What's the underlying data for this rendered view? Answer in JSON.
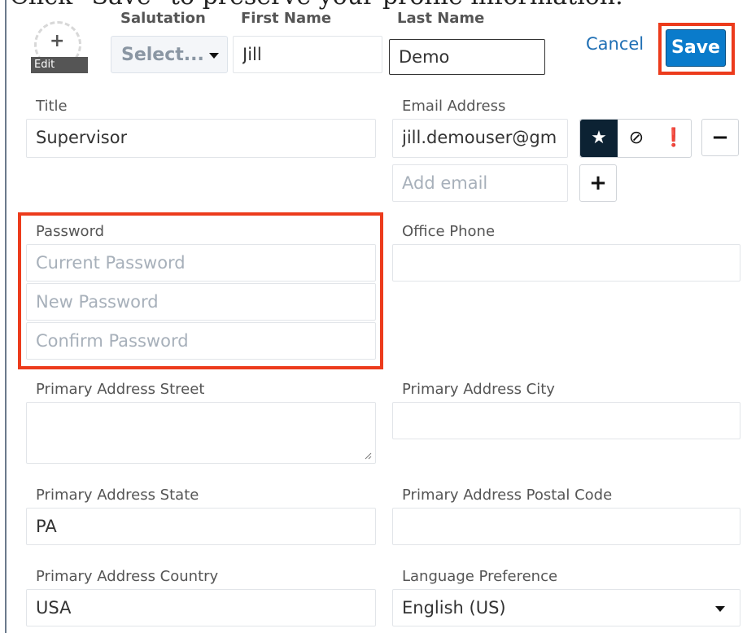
{
  "caption": "Click \"Save\" to preserve your profile information.",
  "header": {
    "avatar_edit_label": "Edit",
    "salutation_label": "Salutation",
    "salutation_value": "Select...",
    "first_name_label": "First Name",
    "first_name_value": "Jill",
    "last_name_label": "Last Name",
    "last_name_value": "Demo",
    "cancel_label": "Cancel",
    "save_label": "Save"
  },
  "form": {
    "title": {
      "label": "Title",
      "value": "Supervisor"
    },
    "email": {
      "label": "Email Address",
      "value": "jill.demouser@gm",
      "add_placeholder": "Add email",
      "icons": [
        "star-icon",
        "opt-out-icon",
        "invalid-icon",
        "minus-icon",
        "plus-icon"
      ]
    },
    "password": {
      "label": "Password",
      "current_placeholder": "Current Password",
      "new_placeholder": "New Password",
      "confirm_placeholder": "Confirm Password"
    },
    "office_phone": {
      "label": "Office Phone",
      "value": ""
    },
    "primary_street": {
      "label": "Primary Address Street",
      "value": ""
    },
    "primary_city": {
      "label": "Primary Address City",
      "value": ""
    },
    "primary_state": {
      "label": "Primary Address State",
      "value": "PA"
    },
    "primary_postal": {
      "label": "Primary Address Postal Code",
      "value": ""
    },
    "primary_country": {
      "label": "Primary Address Country",
      "value": "USA"
    },
    "language": {
      "label": "Language Preference",
      "value": "English (US)"
    }
  },
  "colors": {
    "accent": "#0a7bcb",
    "highlight": "#ec3b1c",
    "primary_star_bg": "#0c2233"
  }
}
